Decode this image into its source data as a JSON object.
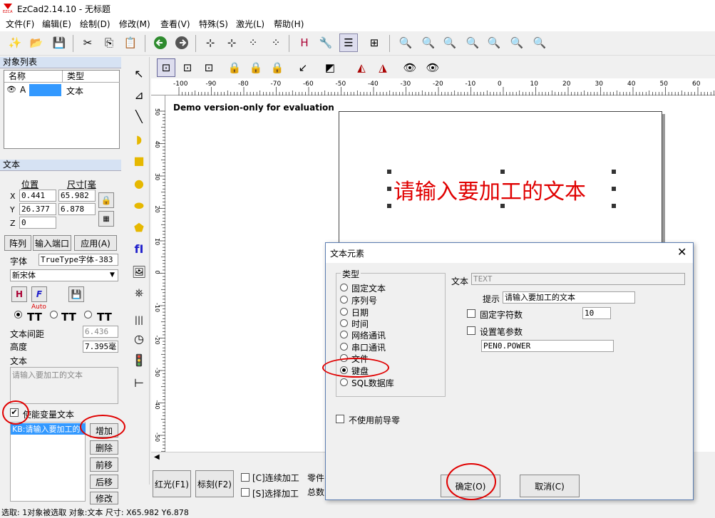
{
  "window": {
    "title": "EzCad2.14.10 - 无标题"
  },
  "menu": [
    "文件(F)",
    "编辑(E)",
    "绘制(D)",
    "修改(M)",
    "查看(V)",
    "特殊(S)",
    "激光(L)",
    "帮助(H)"
  ],
  "object_list": {
    "header": "对象列表",
    "col_name": "名称",
    "col_type": "类型",
    "rows": [
      {
        "name": "A",
        "type": "文本"
      }
    ]
  },
  "text_panel": {
    "header": "文本",
    "pos_label": "位置",
    "size_label": "尺寸[毫",
    "x_label": "X",
    "y_label": "Y",
    "z_label": "Z",
    "x_pos": "0.441",
    "x_size": "65.982",
    "y_pos": "26.377",
    "y_size": "6.878",
    "z_pos": "0",
    "array_btn": "阵列",
    "input_port_btn": "输入端口",
    "apply_btn": "应用(A)",
    "font_label": "字体",
    "font_type": "TrueType字体-383",
    "font_name": "新宋体",
    "auto_label": "Auto",
    "spacing_label": "文本间距",
    "spacing_value": "6.436",
    "height_label": "高度",
    "height_value": "7.395毫",
    "text_label": "文本",
    "text_value": "请输入要加工的文本",
    "enable_var_label": "使能变量文本",
    "var_item": "KB:请输入要加工的",
    "add_btn": "增加",
    "delete_btn": "删除",
    "up_btn": "前移",
    "down_btn": "后移",
    "modify_btn": "修改"
  },
  "canvas": {
    "demo_notice": "Demo version-only for evaluation",
    "text_object": "请输入要加工的文本",
    "ruler_labels": [
      "-100",
      "-90",
      "-80",
      "-70",
      "-60",
      "-50",
      "-40",
      "-30",
      "-20",
      "-10",
      "0",
      "10",
      "20",
      "30",
      "40",
      "50",
      "60"
    ],
    "vruler_labels": [
      "50",
      "40",
      "30",
      "20",
      "10",
      "0",
      "-10",
      "-20",
      "-30",
      "-40",
      "-50"
    ]
  },
  "bottom": {
    "red_btn": "红光(F1)",
    "mark_btn": "标刻(F2)",
    "continuous_label": "[C]连续加工",
    "select_label": "[S]选择加工",
    "parts_label": "零件",
    "total_label": "总数"
  },
  "dialog": {
    "title": "文本元素",
    "type_group": "类型",
    "types": [
      "固定文本",
      "序列号",
      "日期",
      "时间",
      "网络通讯",
      "串口通讯",
      "文件",
      "键盘",
      "SQL数据库"
    ],
    "selected_type": "键盘",
    "text_label": "文本",
    "text_value": "TEXT",
    "prompt_label": "提示",
    "prompt_value": "请输入要加工的文本",
    "fixed_chars_label": "固定字符数",
    "fixed_chars_value": "10",
    "pen_params_label": "设置笔参数",
    "pen_value": "PEN0.POWER",
    "no_leading_zero_label": "不使用前导零",
    "ok_btn": "确定(O)",
    "cancel_btn": "取消(C)"
  },
  "status": "选取: 1对象被选取 对象:文本 尺寸: X65.982 Y6.878",
  "colors": {
    "accent_red": "#e00000",
    "text_object_red": "#e00000",
    "selection_blue": "#3399ff"
  }
}
